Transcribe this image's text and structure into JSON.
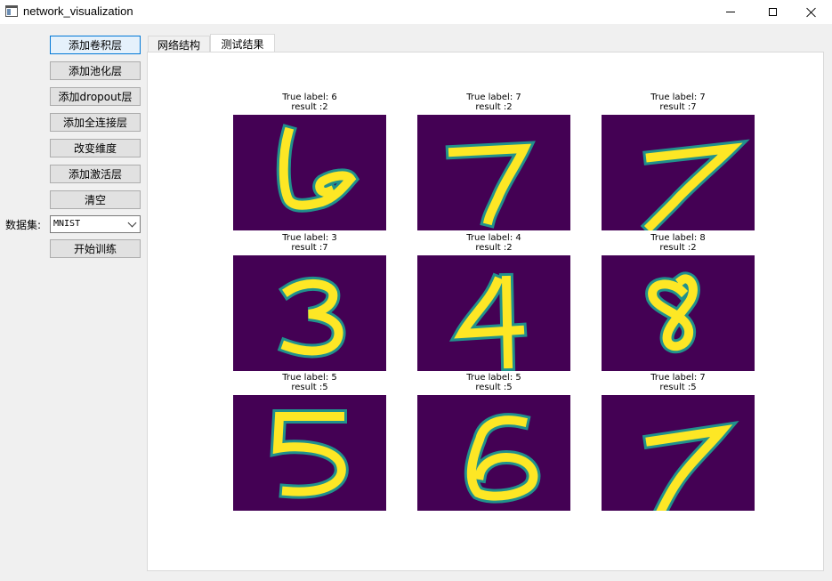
{
  "window": {
    "title": "network_visualization"
  },
  "toolbar": {
    "buttons": [
      "添加卷积层",
      "添加池化层",
      "添加dropout层",
      "添加全连接层",
      "改变维度",
      "添加激活层",
      "清空"
    ],
    "dataset_label": "数据集:",
    "dataset_value": "MNIST",
    "train_label": "开始训练"
  },
  "tabs": [
    "网络结构",
    "测试结果"
  ],
  "active_tab": "测试结果",
  "colors": {
    "digit_background": "#440154",
    "digit_foreground": "#fde725",
    "digit_edge": "#21918c"
  },
  "results": [
    {
      "true_label": "True label: 6",
      "result": "result :2",
      "digit": "6"
    },
    {
      "true_label": "True label: 7",
      "result": "result :2",
      "digit": "7"
    },
    {
      "true_label": "True label: 7",
      "result": "result :7",
      "digit": "7"
    },
    {
      "true_label": "True label: 3",
      "result": "result :7",
      "digit": "3"
    },
    {
      "true_label": "True label: 4",
      "result": "result :2",
      "digit": "4"
    },
    {
      "true_label": "True label: 8",
      "result": "result :2",
      "digit": "8"
    },
    {
      "true_label": "True label: 5",
      "result": "result :5",
      "digit": "5"
    },
    {
      "true_label": "True label: 5",
      "result": "result :5",
      "digit": "6"
    },
    {
      "true_label": "True label: 7",
      "result": "result :5",
      "digit": "7"
    }
  ]
}
